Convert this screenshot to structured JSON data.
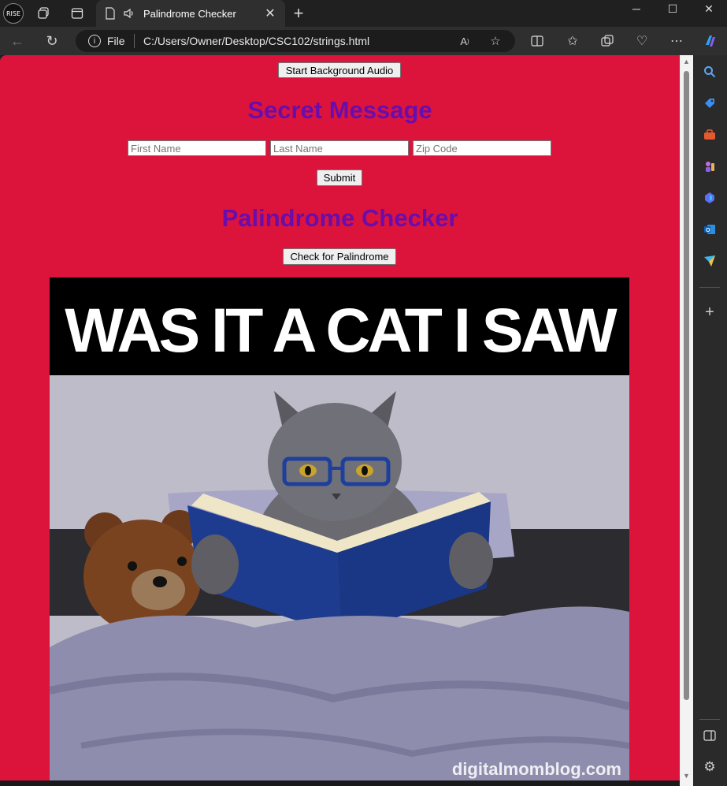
{
  "browser": {
    "profile_label": "RISE",
    "tab_title": "Palindrome Checker",
    "address_scheme_label": "File",
    "address_url": "C:/Users/Owner/Desktop/CSC102/strings.html"
  },
  "page": {
    "audio_button_label": "Start Background Audio",
    "secret_heading": "Secret Message",
    "first_name_placeholder": "First Name",
    "last_name_placeholder": "Last Name",
    "zip_placeholder": "Zip Code",
    "submit_label": "Submit",
    "palindrome_heading": "Palindrome Checker",
    "check_button_label": "Check for Palindrome",
    "poster_text": "WAS IT A CAT I SAW",
    "poster_credit": "digitalmomblog.com",
    "colors": {
      "page_background": "#dc143c",
      "heading": "#6a0dad"
    }
  }
}
